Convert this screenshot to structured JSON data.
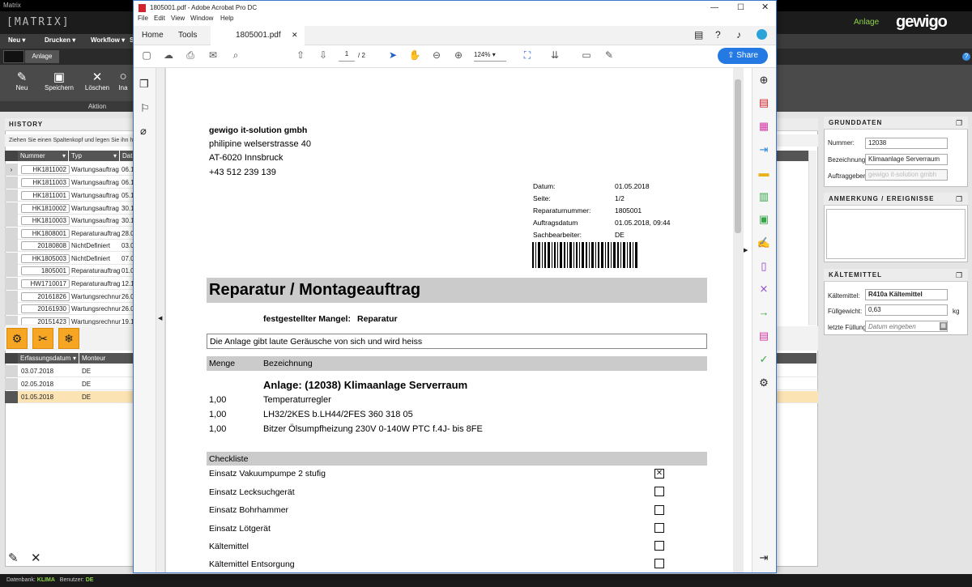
{
  "matrix": {
    "window_title": "Matrix",
    "brand": "[MATRIX]",
    "context_label": "Anlage",
    "logo_text": "gewigo",
    "menu": [
      "Neu ▾",
      "Drucken ▾",
      "Workflow ▾",
      "S"
    ],
    "tab": "Anlage",
    "ribbon": {
      "new": "Neu",
      "save": "Speichern",
      "delete": "Löschen",
      "more": "Ina",
      "group": "Aktion"
    },
    "history": {
      "title": "HISTORY",
      "hint": "Ziehen Sie einen Spaltenkopf und legen Sie ihn hier ab, u",
      "columns": [
        "Nummer",
        "Typ",
        "Datu"
      ],
      "rows": [
        {
          "num": "HK1811002",
          "typ": "Wartungsauftrag",
          "dat": "06.1"
        },
        {
          "num": "HK1811003",
          "typ": "Wartungsauftrag",
          "dat": "06.1"
        },
        {
          "num": "HK1811001",
          "typ": "Wartungsauftrag",
          "dat": "05.1"
        },
        {
          "num": "HK1810002",
          "typ": "Wartungsauftrag",
          "dat": "30.1"
        },
        {
          "num": "HK1810003",
          "typ": "Wartungsauftrag",
          "dat": "30.1"
        },
        {
          "num": "HK1808001",
          "typ": "Reparaturauftrag",
          "dat": "28.0"
        },
        {
          "num": "20180808",
          "typ": "NichtDefiniert",
          "dat": "03.0"
        },
        {
          "num": "HK1805003",
          "typ": "NichtDefiniert",
          "dat": "07.0"
        },
        {
          "num": "1805001",
          "typ": "Reparaturauftrag",
          "dat": "01.0"
        },
        {
          "num": "HW1710017",
          "typ": "Reparaturauftrag",
          "dat": "12.1"
        },
        {
          "num": "20161826",
          "typ": "Wartungsrechnur",
          "dat": "26.0"
        },
        {
          "num": "20161930",
          "typ": "Wartungsrechnur",
          "dat": "26.0"
        },
        {
          "num": "20151423",
          "typ": "Wartungsrechnur",
          "dat": "19.1"
        }
      ],
      "sub_columns": [
        "Erfassungsdatum",
        "Monteur"
      ],
      "sub_rows": [
        {
          "date": "03.07.2018",
          "tech": "DE"
        },
        {
          "date": "02.05.2018",
          "tech": "DE"
        },
        {
          "date": "01.05.2018",
          "tech": "DE"
        }
      ]
    },
    "grunddaten": {
      "title": "GRUNDDATEN",
      "nummer_label": "Nummer:",
      "nummer": "12038",
      "bez_label": "Bezeichnung:",
      "bez": "Klimaanlage Serverraum",
      "auftr_label": "Auftraggeber:",
      "auftr": "gewigo it-solution gmbh"
    },
    "anmerkung": {
      "title": "ANMERKUNG / EREIGNISSE"
    },
    "kaeltemittel": {
      "title": "KÄLTEMITTEL",
      "km_label": "Kältemittel:",
      "km": "R410a Kältemittel",
      "fg_label": "Füllgewicht:",
      "fg": "0,63",
      "fg_unit": "kg",
      "lf_label": "letzte Füllung:",
      "lf_placeholder": "Datum eingeben"
    },
    "status": {
      "db_label": "Datenbank:",
      "db": "KLIMA",
      "user_label": "Benutzer:",
      "user": "DE"
    }
  },
  "acrobat": {
    "title": "1805001.pdf - Adobe Acrobat Pro DC",
    "menu": [
      "File",
      "Edit",
      "View",
      "Window",
      "Help"
    ],
    "nav": {
      "home": "Home",
      "tools": "Tools",
      "doc_tab": "1805001.pdf"
    },
    "page_num": "1",
    "page_total": "/ 2",
    "zoom": "124%",
    "share": "Share"
  },
  "pdf": {
    "company": "gewigo it-solution gmbh",
    "street": "philipine welserstrasse 40",
    "city": "AT-6020 Innsbruck",
    "phone": "+43 512 239 139",
    "meta": [
      {
        "k": "Datum:",
        "v": "01.05.2018"
      },
      {
        "k": "Seite:",
        "v": "1/2"
      },
      {
        "k": "Reparaturnummer:",
        "v": "1805001"
      },
      {
        "k": "Auftragsdatum",
        "v": "01.05.2018, 09:44"
      },
      {
        "k": "Sachbearbeiter:",
        "v": "DE"
      }
    ],
    "heading": "Reparatur / Montageauftrag",
    "defect_label": "festgestellter Mangel:",
    "defect": "Reparatur",
    "description": "Die Anlage gibt laute Geräusche von sich und wird heiss",
    "col_qty": "Menge",
    "col_desc": "Bezeichnung",
    "anlage": "Anlage:  (12038) Klimaanlage Serverraum",
    "items": [
      {
        "qty": "1,00",
        "desc": "Temperaturregler"
      },
      {
        "qty": "1,00",
        "desc": "LH32/2KES b.LH44/2FES 360 318 05"
      },
      {
        "qty": "1,00",
        "desc": "Bitzer Ölsumpfheizung 230V 0-140W PTC f.4J- bis 8FE"
      }
    ],
    "checklist_title": "Checkliste",
    "checklist": [
      {
        "label": "Einsatz Vakuumpumpe 2 stufig",
        "checked": true
      },
      {
        "label": "Einsatz Lecksuchgerät",
        "checked": false
      },
      {
        "label": "Einsatz Bohrhammer",
        "checked": false
      },
      {
        "label": "Einsatz Lötgerät",
        "checked": false
      },
      {
        "label": "Kältemittel",
        "checked": false
      },
      {
        "label": "Kältemittel Entsorgung",
        "checked": false
      }
    ]
  }
}
